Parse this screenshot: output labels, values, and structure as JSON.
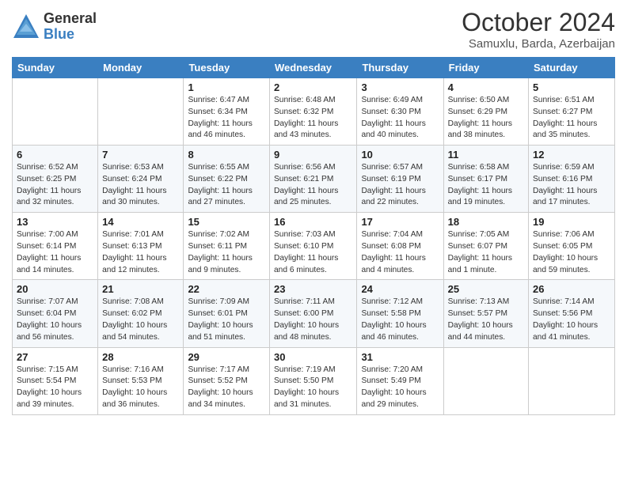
{
  "header": {
    "logo_general": "General",
    "logo_blue": "Blue",
    "month_title": "October 2024",
    "subtitle": "Samuxlu, Barda, Azerbaijan"
  },
  "weekdays": [
    "Sunday",
    "Monday",
    "Tuesday",
    "Wednesday",
    "Thursday",
    "Friday",
    "Saturday"
  ],
  "weeks": [
    [
      {
        "day": "",
        "info": ""
      },
      {
        "day": "",
        "info": ""
      },
      {
        "day": "1",
        "info": "Sunrise: 6:47 AM\nSunset: 6:34 PM\nDaylight: 11 hours and 46 minutes."
      },
      {
        "day": "2",
        "info": "Sunrise: 6:48 AM\nSunset: 6:32 PM\nDaylight: 11 hours and 43 minutes."
      },
      {
        "day": "3",
        "info": "Sunrise: 6:49 AM\nSunset: 6:30 PM\nDaylight: 11 hours and 40 minutes."
      },
      {
        "day": "4",
        "info": "Sunrise: 6:50 AM\nSunset: 6:29 PM\nDaylight: 11 hours and 38 minutes."
      },
      {
        "day": "5",
        "info": "Sunrise: 6:51 AM\nSunset: 6:27 PM\nDaylight: 11 hours and 35 minutes."
      }
    ],
    [
      {
        "day": "6",
        "info": "Sunrise: 6:52 AM\nSunset: 6:25 PM\nDaylight: 11 hours and 32 minutes."
      },
      {
        "day": "7",
        "info": "Sunrise: 6:53 AM\nSunset: 6:24 PM\nDaylight: 11 hours and 30 minutes."
      },
      {
        "day": "8",
        "info": "Sunrise: 6:55 AM\nSunset: 6:22 PM\nDaylight: 11 hours and 27 minutes."
      },
      {
        "day": "9",
        "info": "Sunrise: 6:56 AM\nSunset: 6:21 PM\nDaylight: 11 hours and 25 minutes."
      },
      {
        "day": "10",
        "info": "Sunrise: 6:57 AM\nSunset: 6:19 PM\nDaylight: 11 hours and 22 minutes."
      },
      {
        "day": "11",
        "info": "Sunrise: 6:58 AM\nSunset: 6:17 PM\nDaylight: 11 hours and 19 minutes."
      },
      {
        "day": "12",
        "info": "Sunrise: 6:59 AM\nSunset: 6:16 PM\nDaylight: 11 hours and 17 minutes."
      }
    ],
    [
      {
        "day": "13",
        "info": "Sunrise: 7:00 AM\nSunset: 6:14 PM\nDaylight: 11 hours and 14 minutes."
      },
      {
        "day": "14",
        "info": "Sunrise: 7:01 AM\nSunset: 6:13 PM\nDaylight: 11 hours and 12 minutes."
      },
      {
        "day": "15",
        "info": "Sunrise: 7:02 AM\nSunset: 6:11 PM\nDaylight: 11 hours and 9 minutes."
      },
      {
        "day": "16",
        "info": "Sunrise: 7:03 AM\nSunset: 6:10 PM\nDaylight: 11 hours and 6 minutes."
      },
      {
        "day": "17",
        "info": "Sunrise: 7:04 AM\nSunset: 6:08 PM\nDaylight: 11 hours and 4 minutes."
      },
      {
        "day": "18",
        "info": "Sunrise: 7:05 AM\nSunset: 6:07 PM\nDaylight: 11 hours and 1 minute."
      },
      {
        "day": "19",
        "info": "Sunrise: 7:06 AM\nSunset: 6:05 PM\nDaylight: 10 hours and 59 minutes."
      }
    ],
    [
      {
        "day": "20",
        "info": "Sunrise: 7:07 AM\nSunset: 6:04 PM\nDaylight: 10 hours and 56 minutes."
      },
      {
        "day": "21",
        "info": "Sunrise: 7:08 AM\nSunset: 6:02 PM\nDaylight: 10 hours and 54 minutes."
      },
      {
        "day": "22",
        "info": "Sunrise: 7:09 AM\nSunset: 6:01 PM\nDaylight: 10 hours and 51 minutes."
      },
      {
        "day": "23",
        "info": "Sunrise: 7:11 AM\nSunset: 6:00 PM\nDaylight: 10 hours and 48 minutes."
      },
      {
        "day": "24",
        "info": "Sunrise: 7:12 AM\nSunset: 5:58 PM\nDaylight: 10 hours and 46 minutes."
      },
      {
        "day": "25",
        "info": "Sunrise: 7:13 AM\nSunset: 5:57 PM\nDaylight: 10 hours and 44 minutes."
      },
      {
        "day": "26",
        "info": "Sunrise: 7:14 AM\nSunset: 5:56 PM\nDaylight: 10 hours and 41 minutes."
      }
    ],
    [
      {
        "day": "27",
        "info": "Sunrise: 7:15 AM\nSunset: 5:54 PM\nDaylight: 10 hours and 39 minutes."
      },
      {
        "day": "28",
        "info": "Sunrise: 7:16 AM\nSunset: 5:53 PM\nDaylight: 10 hours and 36 minutes."
      },
      {
        "day": "29",
        "info": "Sunrise: 7:17 AM\nSunset: 5:52 PM\nDaylight: 10 hours and 34 minutes."
      },
      {
        "day": "30",
        "info": "Sunrise: 7:19 AM\nSunset: 5:50 PM\nDaylight: 10 hours and 31 minutes."
      },
      {
        "day": "31",
        "info": "Sunrise: 7:20 AM\nSunset: 5:49 PM\nDaylight: 10 hours and 29 minutes."
      },
      {
        "day": "",
        "info": ""
      },
      {
        "day": "",
        "info": ""
      }
    ]
  ]
}
